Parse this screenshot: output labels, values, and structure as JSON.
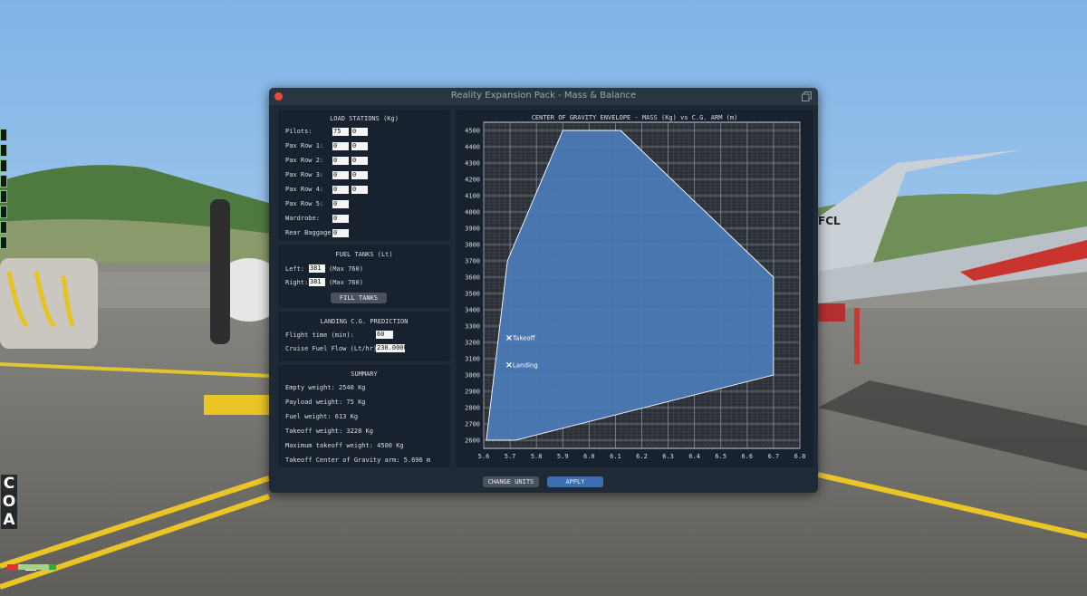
{
  "window": {
    "title": "Reality Expansion Pack - Mass & Balance"
  },
  "load_stations": {
    "title": "LOAD STATIONS (Kg)",
    "rows": [
      {
        "label": "Pilots:",
        "values": [
          "75",
          "0"
        ]
      },
      {
        "label": "Pax Row 1:",
        "values": [
          "0",
          "0"
        ]
      },
      {
        "label": "Pax Row 2:",
        "values": [
          "0",
          "0"
        ]
      },
      {
        "label": "Pax Row 3:",
        "values": [
          "0",
          "0"
        ]
      },
      {
        "label": "Pax Row 4:",
        "values": [
          "0",
          "0"
        ]
      },
      {
        "label": "Pax Row 5:",
        "values": [
          "0"
        ]
      },
      {
        "label": "Wardrobe:",
        "values": [
          "0"
        ]
      },
      {
        "label": "Rear Baggage:",
        "values": [
          "0"
        ]
      }
    ]
  },
  "fuel_tanks": {
    "title": "FUEL TANKS (Lt)",
    "left": {
      "label": "Left:",
      "value": "381",
      "max": "(Max 760)"
    },
    "right": {
      "label": "Right:",
      "value": "381",
      "max": "(Max 760)"
    },
    "fill_label": "FILL TANKS"
  },
  "landing_prediction": {
    "title": "LANDING C.G. PREDICTION",
    "flight_time": {
      "label": "Flight time (min):",
      "value": "60"
    },
    "fuel_flow": {
      "label": "Cruise Fuel Flow (Lt/hr):",
      "value": "230.0000"
    }
  },
  "summary": {
    "title": "SUMMARY",
    "lines": [
      "Empty weight: 2540 Kg",
      "Payload weight: 75 Kg",
      "Fuel weight: 613 Kg",
      "Takeoff weight: 3228 Kg",
      "Maximum takeoff weight: 4500 Kg",
      "Takeoff Center of Gravity arm: 5.696 m"
    ]
  },
  "buttons": {
    "change_units": "CHANGE UNITS",
    "apply": "APPLY"
  },
  "hud": {
    "letters": [
      "C",
      "O",
      "A"
    ]
  },
  "chart_data": {
    "type": "area",
    "title": "CENTER OF GRAVITY ENVELOPE - MASS (Kg) vs C.G. ARM (m)",
    "xlabel": "",
    "ylabel": "",
    "xlim": [
      5.6,
      6.8
    ],
    "ylim": [
      2550,
      4550
    ],
    "x_ticks": [
      "5.6",
      "5.7",
      "5.8",
      "5.9",
      "6.0",
      "6.1",
      "6.2",
      "6.3",
      "6.4",
      "6.5",
      "6.6",
      "6.7",
      "6.8"
    ],
    "y_ticks": [
      "2600",
      "2700",
      "2800",
      "2900",
      "3000",
      "3100",
      "3200",
      "3300",
      "3400",
      "3500",
      "3600",
      "3700",
      "3800",
      "3900",
      "4000",
      "4100",
      "4200",
      "4300",
      "4400",
      "4500"
    ],
    "grid": true,
    "envelope": [
      [
        5.61,
        2600
      ],
      [
        5.72,
        2600
      ],
      [
        6.7,
        3000
      ],
      [
        6.7,
        3600
      ],
      [
        6.12,
        4500
      ],
      [
        5.9,
        4500
      ],
      [
        5.69,
        3700
      ]
    ],
    "points": [
      {
        "label": "Takeoff",
        "x": 5.696,
        "y": 3228
      },
      {
        "label": "Landing",
        "x": 5.696,
        "y": 3062
      }
    ],
    "fill_color": "#4a79b4",
    "outline_color": "#ffffff"
  }
}
